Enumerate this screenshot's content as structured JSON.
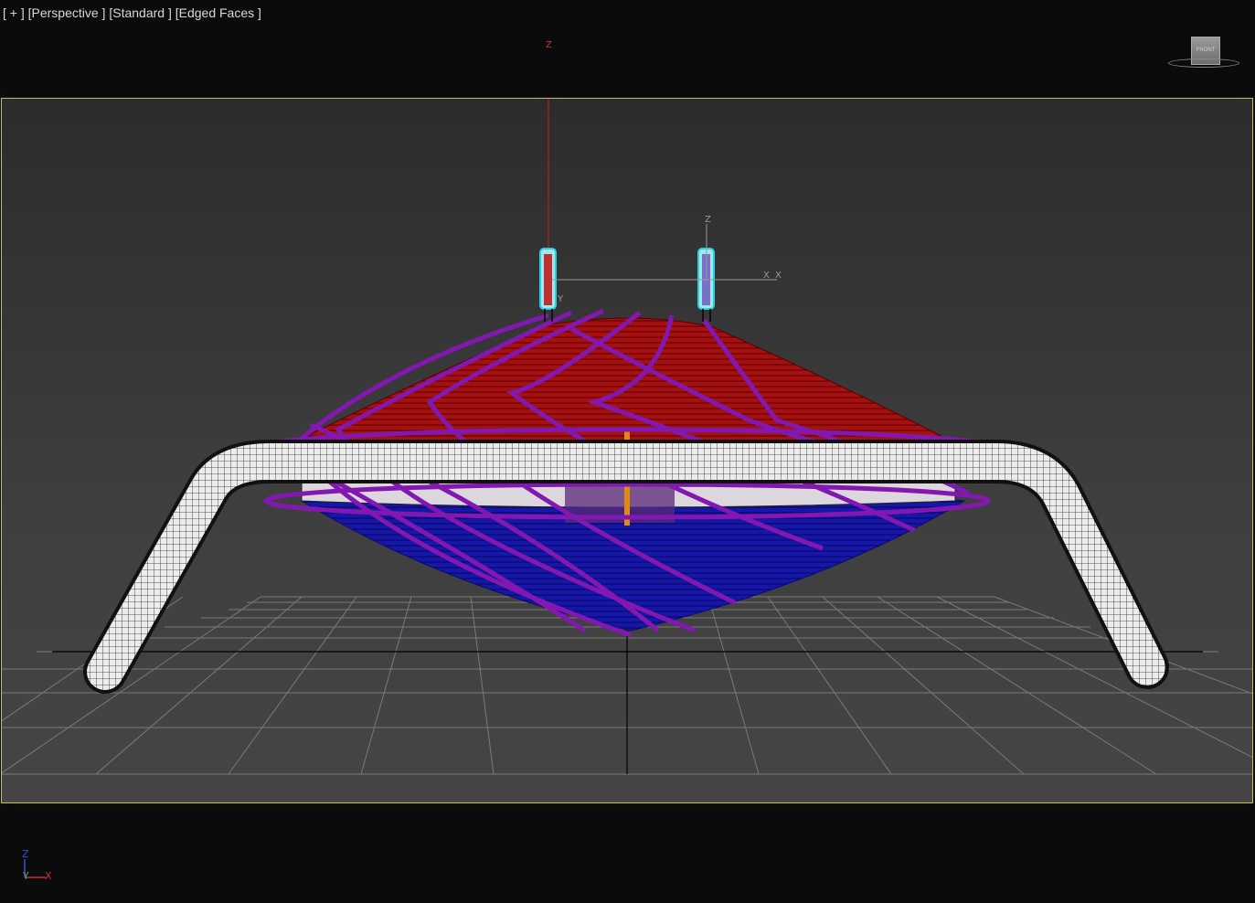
{
  "viewport": {
    "labels": [
      "[ + ]",
      "[Perspective ]",
      "[Standard ]",
      "[Edged Faces ]"
    ],
    "active_border_color": "#c8c23a"
  },
  "viewcube": {
    "face_label": "FRONT"
  },
  "gizmo": {
    "z_label": "Z",
    "x_label": "X",
    "y_label": "Y",
    "x2_label": "X"
  },
  "world_axis": {
    "z": "Z",
    "y": "Y",
    "x": "X",
    "z_color": "#3a4fd6",
    "y_color": "#3bb24a",
    "x_color": "#d23030"
  },
  "scene_colors": {
    "upper_mesh": "#b01414",
    "lower_mesh": "#1a1ab0",
    "spline": "#8a1ab8",
    "tube": "#e8e8e8",
    "grid": "#777777"
  }
}
